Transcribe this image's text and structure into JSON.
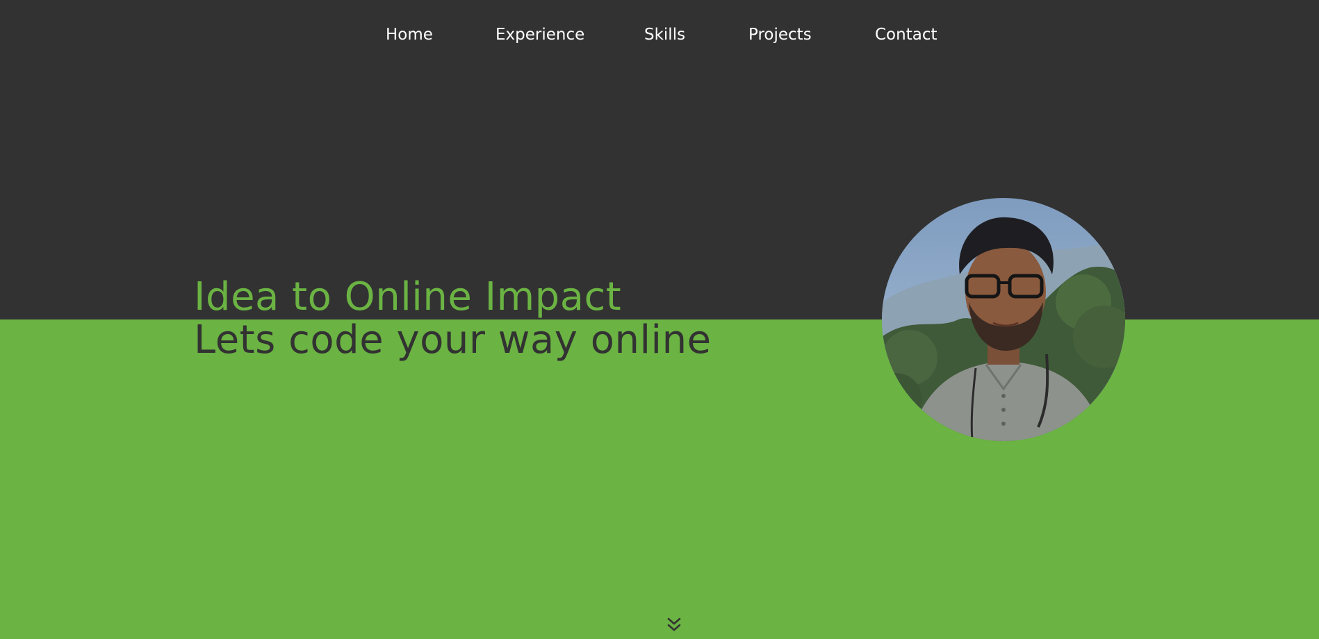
{
  "nav": {
    "items": [
      {
        "label": "Home"
      },
      {
        "label": "Experience"
      },
      {
        "label": "Skills"
      },
      {
        "label": "Projects"
      },
      {
        "label": "Contact"
      }
    ]
  },
  "hero": {
    "title": "Idea to Online Impact",
    "subtitle": "Lets code your way online"
  },
  "icons": {
    "profile_photo": "profile-photo",
    "scroll_down": "double-chevron-down-icon"
  },
  "colors": {
    "dark": "#323232",
    "accent_green": "#6bb343",
    "nav_text": "#ffffff"
  }
}
